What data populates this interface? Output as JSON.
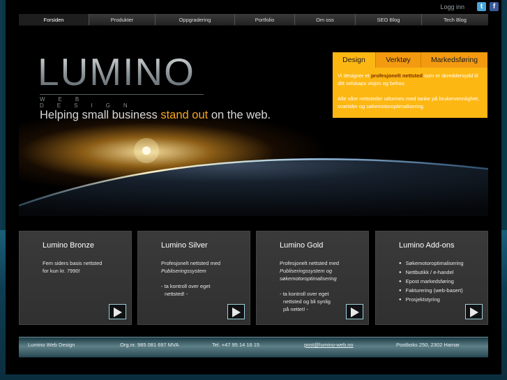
{
  "header": {
    "login": "Logg inn",
    "social": {
      "twitter_glyph": "t",
      "facebook_glyph": "f"
    }
  },
  "nav": {
    "items": [
      "Forsiden",
      "Produkter",
      "Oppgradering",
      "Portfolio",
      "Om oss",
      "SEO Blog",
      "Tech Blog"
    ],
    "active": "Forsiden"
  },
  "hero": {
    "logo": "LUMINO",
    "logo_sub": "WEB DESIGN",
    "tagline_pre": "Helping small business ",
    "tagline_highlight": "stand out",
    "tagline_post": " on the web."
  },
  "tabs": {
    "items": [
      "Design",
      "Verktøy",
      "Markedsføring"
    ],
    "active": "Design",
    "para1_pre": "Vi designer et ",
    "para1_bold": "profesjonelt nettsted",
    "para1_post": " som er skreddersydd til ditt selskaps visjon og behov.",
    "para2": "Alle våre nettsteder utformes med tanke på brukervennlighet, svartider og søkemotoroptimalisering."
  },
  "products": {
    "bronze": {
      "title": "Lumino Bronze",
      "line1": "Fem siders basis nettsted",
      "line2": "for kun kr. 7990!"
    },
    "silver": {
      "title": "Lumino Silver",
      "line1": "Profesjonelt nettsted med",
      "line2": "Publiseringssystem",
      "line3": "- ta kontroll over eget",
      "line4": "nettsted! -"
    },
    "gold": {
      "title": "Lumino Gold",
      "line1": "Profesjonelt nettsted med",
      "line2": "Publiseringssystem og",
      "line3": "søkemotoroptimalisering",
      "line4": "- ta kontroll over eget",
      "line5": "nettsted og bli synlig",
      "line6": "på nettet! -"
    },
    "addons": {
      "title": "Lumino Add-ons",
      "items": [
        "Søkemotoroptimalisering",
        "Nettbutikk / e-handel",
        "Epost markedsføring",
        "Fakturering (web-basert)",
        "Prosjektstyring"
      ]
    }
  },
  "footer": {
    "company": "Lumino Web Design",
    "org": "Org.nr. 985 081 697 MVA",
    "phone": "Tel. +47 95 14 16 15",
    "email": "post@lumino-web.no",
    "address": "Postboks 250, 2302 Hamar"
  },
  "colors": {
    "accent_orange": "#fdb713",
    "tagline_highlight": "#f5a623",
    "page_bg": "#000000",
    "outer_bg": "#0a2a38"
  }
}
